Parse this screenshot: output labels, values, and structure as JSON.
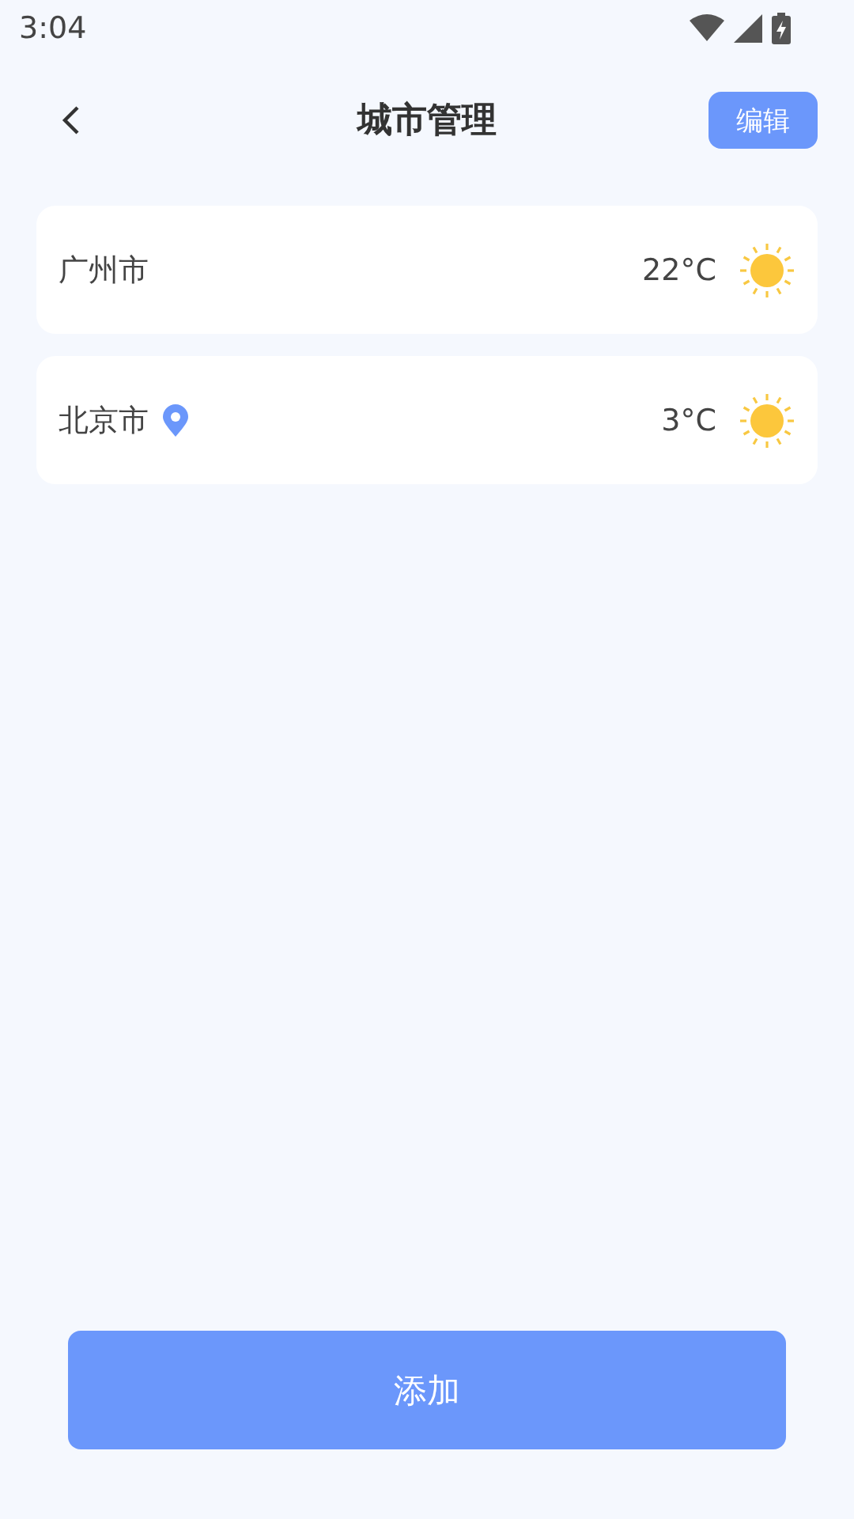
{
  "status_bar": {
    "time": "3:04"
  },
  "header": {
    "title": "城市管理",
    "edit_button": "编辑"
  },
  "cities": [
    {
      "name": "广州市",
      "located": false,
      "temperature": "22°C",
      "kind": "sunny"
    },
    {
      "name": "北京市",
      "located": true,
      "temperature": "3°C",
      "kind": "sunny"
    }
  ],
  "add_button": {
    "label": "添加"
  }
}
